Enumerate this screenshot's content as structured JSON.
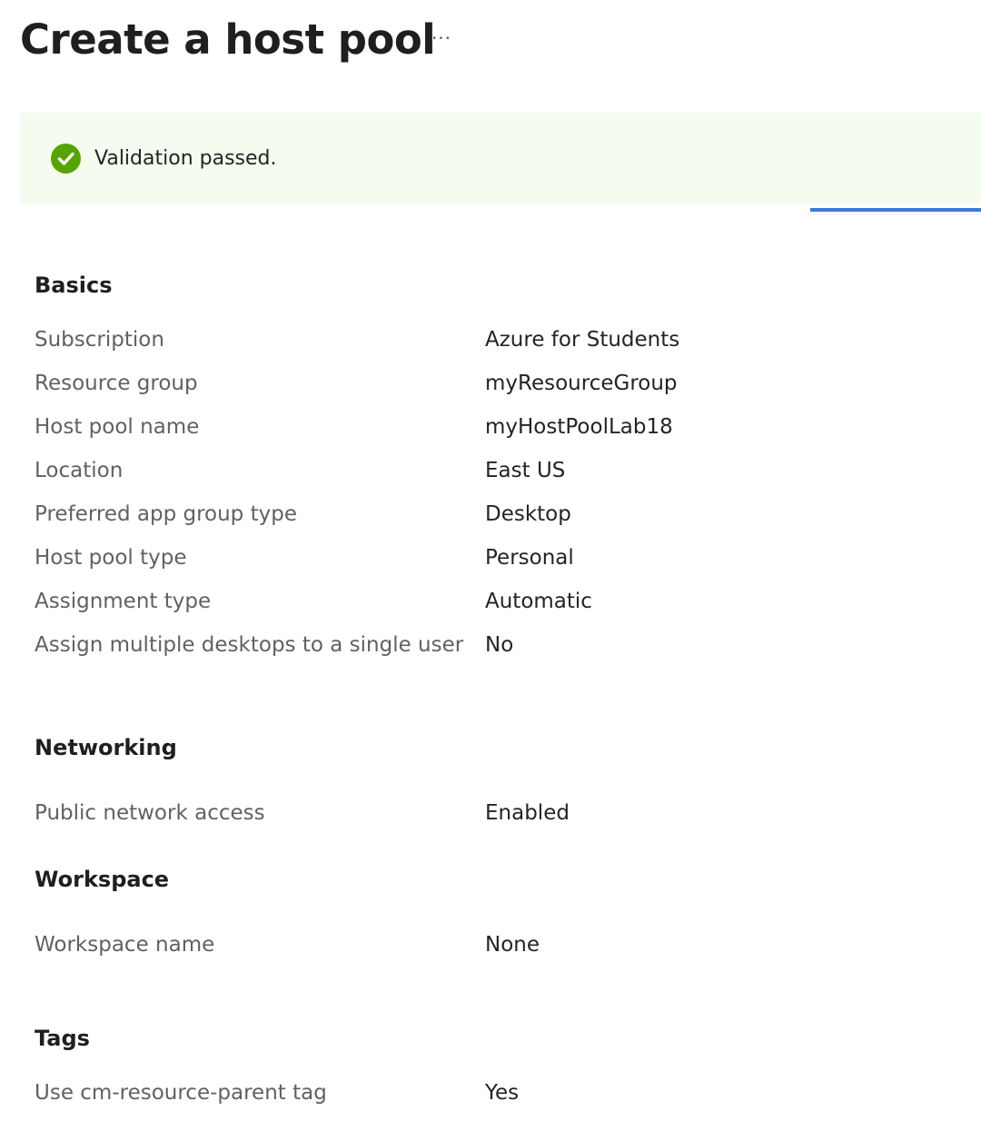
{
  "header": {
    "title": "Create a host pool",
    "more_label": "···"
  },
  "banner": {
    "status": "success",
    "icon": "checkmark-circle-icon",
    "color": "#57a300",
    "background": "#f3fcef",
    "message": "Validation passed."
  },
  "progress": {
    "color": "#3a7bd5"
  },
  "sections": {
    "basics": {
      "heading": "Basics",
      "rows": [
        {
          "label": "Subscription",
          "value": "Azure for Students"
        },
        {
          "label": "Resource group",
          "value": "myResourceGroup"
        },
        {
          "label": "Host pool name",
          "value": "myHostPoolLab18"
        },
        {
          "label": "Location",
          "value": "East US"
        },
        {
          "label": "Preferred app group type",
          "value": "Desktop"
        },
        {
          "label": "Host pool type",
          "value": "Personal"
        },
        {
          "label": "Assignment type",
          "value": "Automatic"
        },
        {
          "label": "Assign multiple desktops to a single user",
          "value": "No"
        }
      ]
    },
    "networking": {
      "heading": "Networking",
      "rows": [
        {
          "label": "Public network access",
          "value": "Enabled"
        }
      ]
    },
    "workspace": {
      "heading": "Workspace",
      "rows": [
        {
          "label": "Workspace name",
          "value": "None"
        }
      ]
    },
    "tags": {
      "heading": "Tags",
      "rows": [
        {
          "label": "Use cm-resource-parent tag",
          "value": "Yes"
        }
      ]
    }
  }
}
